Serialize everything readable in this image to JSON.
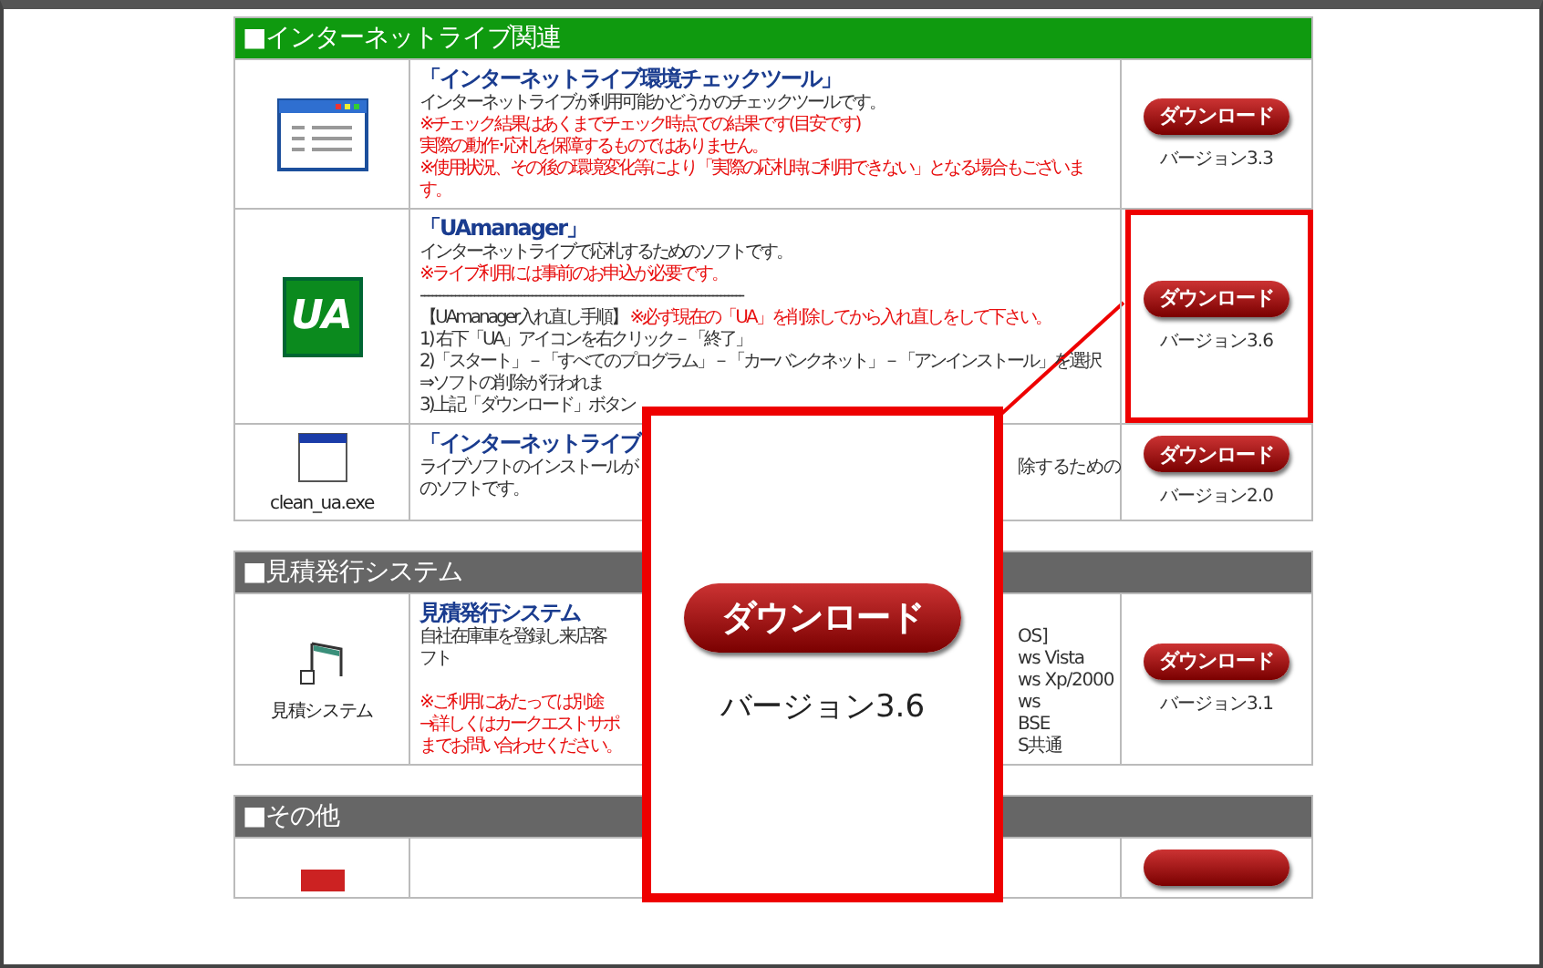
{
  "sections": [
    {
      "title": "■インターネットライブ関連",
      "color": "#0f9a0f",
      "rows": [
        {
          "kind": "window",
          "title": "「インターネットライブ環境チェックツール」",
          "lines": [
            {
              "parts": [
                {
                  "text": "インターネットライブが利用可能かどうかのチェックツールです。",
                  "warning": false
                }
              ]
            },
            {
              "parts": [
                {
                  "text": "※チェック結果はあくまでチェック時点での結果です(目安です)",
                  "warning": true
                }
              ]
            },
            {
              "parts": [
                {
                  "text": "実際の動作･応札を保障するものではありません。",
                  "warning": true
                }
              ]
            },
            {
              "parts": [
                {
                  "text": "※使用状況、その後の環境変化等により「実際の応札時に利用できない」となる場合もございます。",
                  "warning": true
                }
              ]
            }
          ],
          "download": {
            "label": "ダウンロード",
            "version": "バージョン3.3"
          },
          "highlighted": false
        },
        {
          "kind": "ua",
          "icon_text": "UA",
          "title": "「UAmanager」",
          "lines": [
            {
              "parts": [
                {
                  "text": "インターネットライブで応札するためのソフトです。",
                  "warning": false
                }
              ]
            },
            {
              "parts": [
                {
                  "text": "※ライブ利用には事前のお申込が必要です。",
                  "warning": true
                }
              ]
            },
            {
              "parts": [
                {
                  "text": "------------------------------------------------------------------------------------",
                  "warning": false
                }
              ]
            },
            {
              "parts": [
                {
                  "text": "【UAmanager入れ直し手順】 ",
                  "warning": false
                },
                {
                  "text": "※必ず現在の「UA」を削除してから入れ直しをして下さい。",
                  "warning": true
                }
              ]
            },
            {
              "parts": [
                {
                  "text": "1) 右下「UA」アイコンを右クリック－「終了」",
                  "warning": false
                }
              ]
            },
            {
              "parts": [
                {
                  "text": "2)「スタート」－「すべてのプログラム」－「カーバンクネット」－「アンインストール」を選択",
                  "warning": false
                }
              ]
            },
            {
              "parts": [
                {
                  "text": "⇒ソフトの削除が行われま",
                  "warning": false
                }
              ]
            },
            {
              "parts": [
                {
                  "text": "3)上記「ダウンロード」ボタン",
                  "warning": false
                }
              ]
            }
          ],
          "download": {
            "label": "ダウンロード",
            "version": "バージョン3.6"
          },
          "highlighted": true
        },
        {
          "kind": "small-window",
          "icon_label": "clean_ua.exe",
          "title": "「インターネットライブ",
          "lines": [
            {
              "parts": [
                {
                  "text": "ライブソフトのインストールが",
                  "warning": false
                }
              ],
              "side": "除するための"
            },
            {
              "parts": [
                {
                  "text": "のソフトです。",
                  "warning": false
                }
              ]
            }
          ],
          "download": {
            "label": "ダウンロード",
            "version": "バージョン2.0"
          },
          "highlighted": false
        }
      ]
    },
    {
      "title": "■見積発行システム",
      "color": "#666666",
      "rows": [
        {
          "kind": "notes",
          "icon_label": "見積システム",
          "title": "見積発行システム",
          "lines": [
            {
              "parts": [
                {
                  "text": "自社在庫車を登録し来店客",
                  "warning": false
                }
              ],
              "side": "OS]"
            },
            {
              "parts": [
                {
                  "text": "フト",
                  "warning": false
                }
              ],
              "side": "ws Vista"
            },
            {
              "side": "ws Xp/2000"
            },
            {
              "parts": [
                {
                  "text": "※ご利用にあたっては別途",
                  "warning": true
                }
              ],
              "side": "ws"
            },
            {
              "parts": [
                {
                  "text": "→詳しくはカークエストサポ",
                  "warning": true
                }
              ],
              "side": "BSE"
            },
            {
              "parts": [
                {
                  "text": "までお問い合わせください。",
                  "warning": true
                }
              ],
              "side": "S共通"
            }
          ],
          "download": {
            "label": "ダウンロード",
            "version": "バージョン3.1"
          },
          "highlighted": false
        }
      ]
    },
    {
      "title": "■その他",
      "color": "#666666",
      "rows": [
        {
          "kind": "red-block",
          "lines": [],
          "download": {},
          "highlighted": false
        }
      ]
    }
  ],
  "callout": {
    "button": "ダウンロード",
    "version": "バージョン3.6"
  }
}
